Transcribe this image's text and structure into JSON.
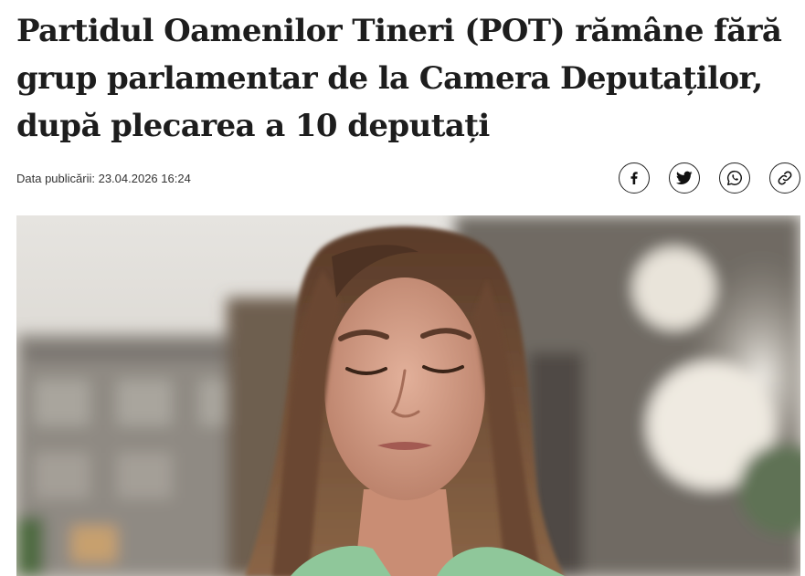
{
  "article": {
    "title": "Partidul Oamenilor Tineri (POT) rămâne fără grup parlamentar de la Camera Deputaților, după plecarea a 10 deputați",
    "published_label": "Data publicării: 23.04.2026 16:24"
  },
  "share": {
    "buttons": [
      {
        "icon": "facebook-icon"
      },
      {
        "icon": "twitter-icon"
      },
      {
        "icon": "whatsapp-icon"
      },
      {
        "icon": "link-icon"
      }
    ]
  },
  "colors": {
    "text": "#1d1d1d",
    "jacket": "#8fc79a",
    "hair": "#6e4a32"
  }
}
